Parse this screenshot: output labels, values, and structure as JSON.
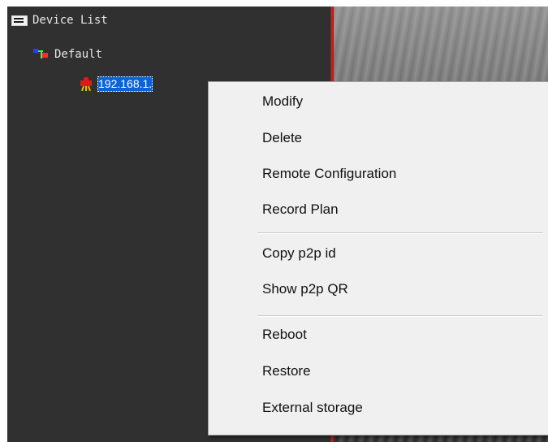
{
  "tree": {
    "root_label": "Device List",
    "group_label": "Default",
    "device_label": "192.168.1."
  },
  "context_menu": {
    "items": [
      "Modify",
      "Delete",
      "Remote Configuration",
      "Record Plan",
      "Copy p2p id",
      "Show p2p QR",
      "Reboot",
      "Restore",
      "External storage"
    ]
  },
  "icons": {
    "root": "device-list-icon",
    "group": "group-tree-icon",
    "device": "camera-icon"
  },
  "colors": {
    "panel_bg": "#303030",
    "selection": "#0a64d8",
    "menu_bg": "#f0f0f0",
    "divider": "#e02020"
  }
}
